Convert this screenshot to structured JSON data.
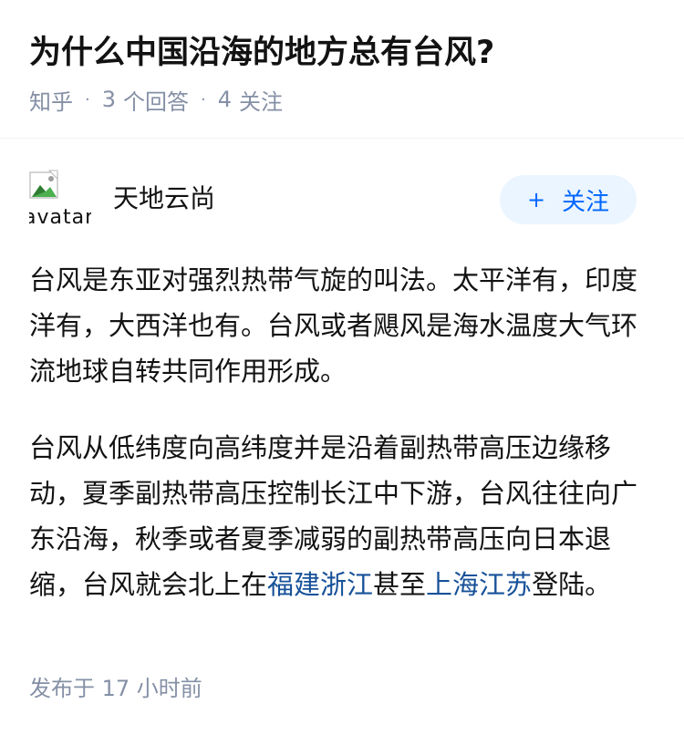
{
  "question": {
    "title": "为什么中国沿海的地方总有台风?"
  },
  "meta": {
    "source": "知乎",
    "separator": "·",
    "answer_count": "3",
    "answer_label": "个回答",
    "follower_count": "4",
    "follower_label": "关注"
  },
  "author": {
    "avatar_alt": "avatar",
    "name": "天地云尚",
    "follow_label": "+ 关注",
    "follow_plus": "+",
    "follow_text": "关注"
  },
  "answer": {
    "paragraph_1": "台风是东亚对强烈热带气旋的叫法。太平洋有，印度洋有，大西洋也有。台风或者飓风是海水温度大气环流地球自转共同作用形成。",
    "paragraph_2_part_1": "台风从低纬度向高纬度并是沿着副热带高压边缘移动，夏季副热带高压控制长江中下游，台风往往向广东沿海，秋季或者夏季减弱的副热带高压向日本退缩，台风就会北上在",
    "link_1": "福建浙江",
    "paragraph_2_part_2": "甚至",
    "link_2": "上海江苏",
    "paragraph_2_part_3": "登陆。"
  },
  "footer": {
    "publish_time": "发布于 17 小时前"
  },
  "colors": {
    "meta_gray": "#8590a6",
    "link_blue": "#175199",
    "follow_bg": "#ebf5ff",
    "follow_text": "#0066ff"
  }
}
